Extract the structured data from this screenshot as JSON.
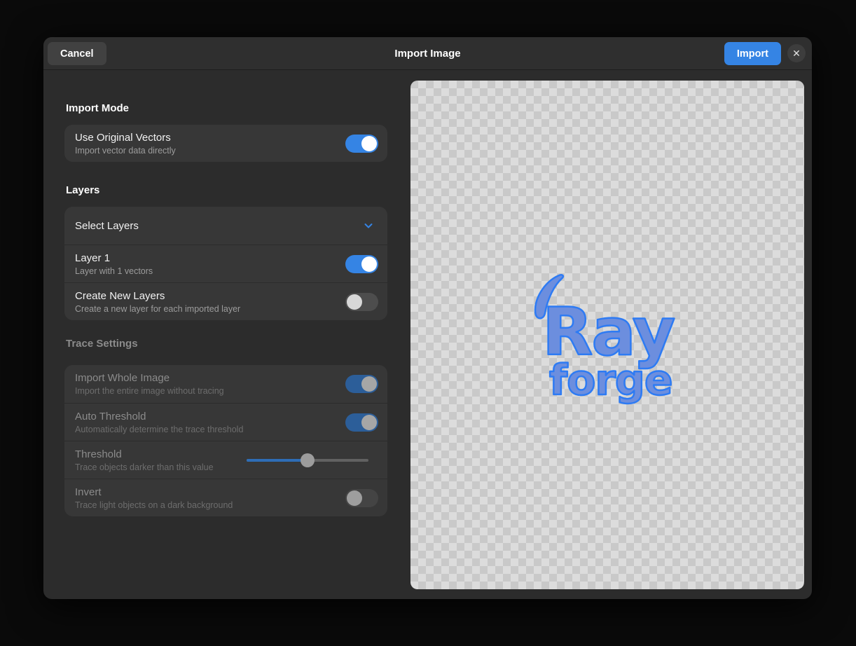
{
  "header": {
    "title": "Import Image",
    "cancel_label": "Cancel",
    "import_label": "Import",
    "close_glyph": "✕"
  },
  "colors": {
    "accent": "#3584e4",
    "logo_fill": "#6c8ede",
    "logo_stroke": "#2e7bf3"
  },
  "import_mode": {
    "heading": "Import Mode",
    "rows": [
      {
        "title": "Use Original Vectors",
        "subtitle": "Import vector data directly",
        "toggle": "on"
      }
    ]
  },
  "layers": {
    "heading": "Layers",
    "select_row": {
      "title": "Select Layers",
      "expanded": false
    },
    "rows": [
      {
        "title": "Layer 1",
        "subtitle": "Layer with 1 vectors",
        "toggle": "on"
      },
      {
        "title": "Create New Layers",
        "subtitle": "Create a new layer for each imported layer",
        "toggle": "off"
      }
    ]
  },
  "trace_settings": {
    "heading": "Trace Settings",
    "disabled": true,
    "rows": [
      {
        "title": "Import Whole Image",
        "subtitle": "Import the entire image without tracing",
        "toggle": "on"
      },
      {
        "title": "Auto Threshold",
        "subtitle": "Automatically determine the trace threshold",
        "toggle": "on"
      },
      {
        "title": "Threshold",
        "subtitle": "Trace objects darker than this value",
        "slider_percent": 50
      },
      {
        "title": "Invert",
        "subtitle": "Trace light objects on a dark background",
        "toggle": "off"
      }
    ]
  },
  "preview": {
    "logo_line1": "Ray",
    "logo_line2": "forge"
  }
}
